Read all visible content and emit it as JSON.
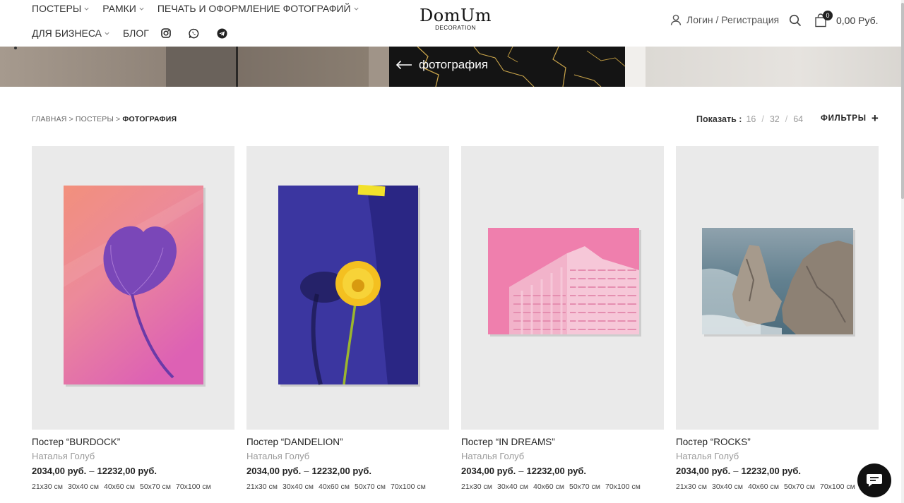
{
  "header": {
    "nav_row1": [
      {
        "label": "ПОСТЕРЫ",
        "dropdown": true
      },
      {
        "label": "РАМКИ",
        "dropdown": true
      },
      {
        "label": "ПЕЧАТЬ И ОФОРМЛЕНИЕ ФОТОГРАФИЙ",
        "dropdown": true
      }
    ],
    "nav_row2": [
      {
        "label": "ДЛЯ БИЗНЕСА",
        "dropdown": true
      },
      {
        "label": "БЛОГ",
        "dropdown": false
      }
    ],
    "social_icons": [
      "instagram-icon",
      "whatsapp-icon",
      "telegram-icon"
    ],
    "logo": {
      "title": "DomUm",
      "subtitle": "DECORATION"
    },
    "account_link": "Логин / Регистрация",
    "cart": {
      "count": "0",
      "total": "0,00 Руб."
    }
  },
  "hero": {
    "back_label": "фотография"
  },
  "breadcrumb": {
    "items": [
      "ГЛАВНАЯ",
      "ПОСТЕРЫ"
    ],
    "separator": ">",
    "current": "ФОТОГРАФИЯ"
  },
  "toolbar": {
    "show_label": "Показать :",
    "show_options": [
      "16",
      "32",
      "64"
    ],
    "option_separator": "/",
    "filters_label": "ФИЛЬТРЫ"
  },
  "products": [
    {
      "title": "Постер “BURDOCK”",
      "author": "Наталья Голуб",
      "price_from": "2034,00 руб.",
      "price_sep": "–",
      "price_to": "12232,00 руб.",
      "sizes": [
        "21x30 см",
        "30x40 см",
        "40x60 см",
        "50x70 см",
        "70x100 см"
      ]
    },
    {
      "title": "Постер “DANDELION”",
      "author": "Наталья Голуб",
      "price_from": "2034,00 руб.",
      "price_sep": "–",
      "price_to": "12232,00 руб.",
      "sizes": [
        "21x30 см",
        "30x40 см",
        "40x60 см",
        "50x70 см",
        "70x100 см"
      ]
    },
    {
      "title": "Постер “IN DREAMS”",
      "author": "Наталья Голуб",
      "price_from": "2034,00 руб.",
      "price_sep": "–",
      "price_to": "12232,00 руб.",
      "sizes": [
        "21x30 см",
        "30x40 см",
        "40x60 см",
        "50x70 см",
        "70x100 см"
      ]
    },
    {
      "title": "Постер “ROCKS”",
      "author": "Наталья Голуб",
      "price_from": "2034,00 руб.",
      "price_sep": "–",
      "price_to": "12232,00 руб.",
      "sizes": [
        "21x30 см",
        "30x40 см",
        "40x60 см",
        "50x70 см",
        "70x100 см"
      ]
    }
  ],
  "chat_widget": {
    "icon": "chat-icon"
  }
}
